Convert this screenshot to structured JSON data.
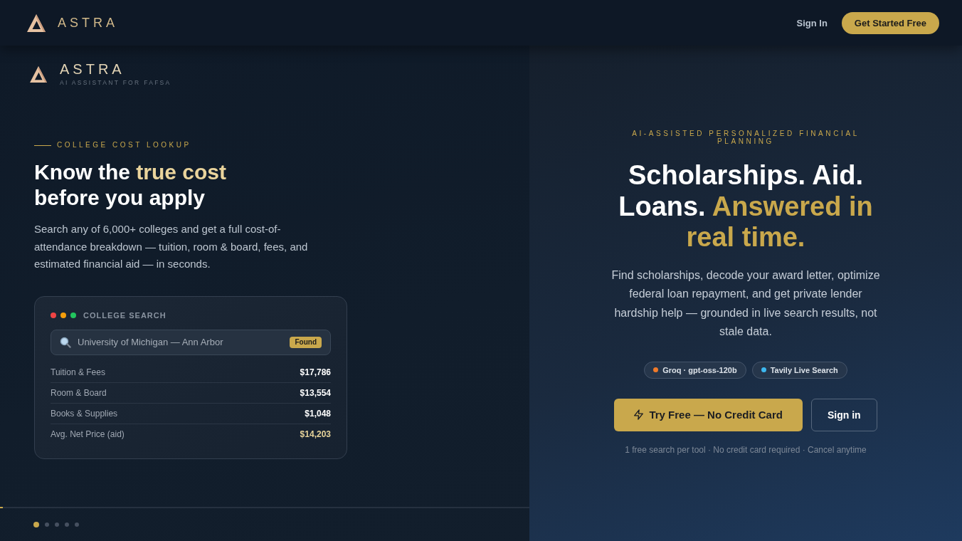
{
  "nav": {
    "brand": "ASTRA",
    "links": [
      {
        "label": "Sign In",
        "kind": "link"
      },
      {
        "label": "Get Started Free",
        "kind": "button"
      }
    ]
  },
  "lookup_panel": {
    "brand": {
      "name": "ASTRA",
      "tagline": "AI ASSISTANT FOR FAFSA"
    },
    "eyebrow": "COLLEGE COST LOOKUP",
    "heading": [
      {
        "text": "Know the",
        "accent": false
      },
      {
        "text": "true cost",
        "accent": true
      },
      {
        "text": "before you apply",
        "accent": false
      }
    ],
    "description": "Search any of 6,000+ colleges and get a full cost-of-attendance breakdown — tuition, room & board, fees, and estimated financial aid — in seconds.",
    "card": {
      "title": "COLLEGE SEARCH",
      "window_dots": [
        {
          "color": "#ef4444"
        },
        {
          "color": "#f59e0b"
        },
        {
          "color": "#22c55e"
        }
      ],
      "search": {
        "value": "University of Michigan — Ann Arbor",
        "badge": "Found"
      },
      "rows": [
        {
          "label": "Tuition & Fees",
          "value": "$17,786",
          "highlight": false
        },
        {
          "label": "Room & Board",
          "value": "$13,554",
          "highlight": false
        },
        {
          "label": "Books & Supplies",
          "value": "$1,048",
          "highlight": false
        },
        {
          "label": "Avg. Net Price (aid)",
          "value": "$14,203",
          "highlight": true
        }
      ]
    },
    "slider": {
      "progress": {
        "level": 0.005
      },
      "slides": [
        {
          "selected": true
        },
        {
          "selected": false
        },
        {
          "selected": false
        },
        {
          "selected": false
        },
        {
          "selected": false
        }
      ]
    }
  },
  "hero_panel": {
    "eyebrow": "AI-ASSISTED PERSONALIZED FINANCIAL PLANNING",
    "heading": [
      {
        "text": "Scholarships. Aid. Loans.",
        "accent": false
      },
      {
        "text": "Answered in real time.",
        "accent": true
      }
    ],
    "description": "Find scholarships, decode your award letter, optimize federal loan repayment, and get private lender hardship help — grounded in live search results, not stale data.",
    "badges": [
      {
        "label": "Groq · gpt-oss-120b",
        "color": "#f07a2a"
      },
      {
        "label": "Tavily Live Search",
        "color": "#3db8f0"
      }
    ],
    "actions": [
      {
        "label": "Try Free — No Credit Card",
        "kind": "primary"
      },
      {
        "label": "Sign in",
        "kind": "secondary"
      }
    ],
    "footnote": "1 free search per tool · No credit card required · Cancel anytime"
  }
}
